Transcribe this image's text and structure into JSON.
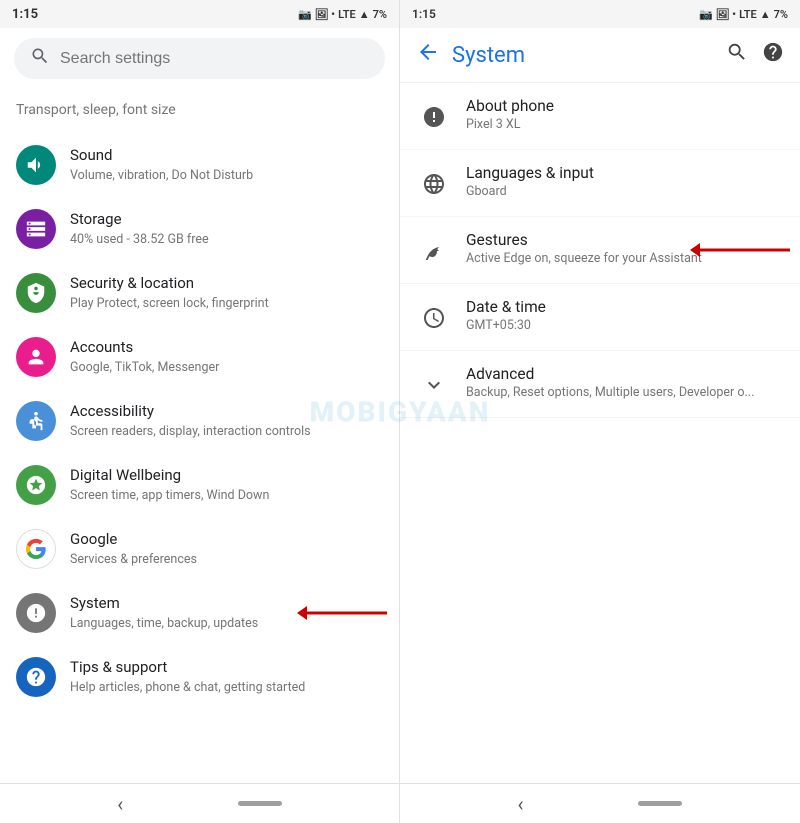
{
  "left_panel": {
    "status_bar": {
      "time": "1:15",
      "signal": "LTE",
      "battery": "7%"
    },
    "search": {
      "placeholder": "Search settings"
    },
    "truncated_item": {
      "text": "Transport, sleep, font size"
    },
    "items": [
      {
        "id": "sound",
        "icon_symbol": "🔊",
        "icon_class": "icon-teal",
        "title": "Sound",
        "subtitle": "Volume, vibration, Do Not Disturb"
      },
      {
        "id": "storage",
        "icon_symbol": "☰",
        "icon_class": "icon-purple",
        "title": "Storage",
        "subtitle": "40% used - 38.52 GB free"
      },
      {
        "id": "security",
        "icon_symbol": "🔒",
        "icon_class": "icon-green",
        "title": "Security & location",
        "subtitle": "Play Protect, screen lock, fingerprint"
      },
      {
        "id": "accounts",
        "icon_symbol": "👤",
        "icon_class": "icon-pink",
        "title": "Accounts",
        "subtitle": "Google, TikTok, Messenger"
      },
      {
        "id": "accessibility",
        "icon_symbol": "♿",
        "icon_class": "icon-blue-light",
        "title": "Accessibility",
        "subtitle": "Screen readers, display, interaction controls"
      },
      {
        "id": "digital-wellbeing",
        "icon_symbol": "⏱",
        "icon_class": "icon-green2",
        "title": "Digital Wellbeing",
        "subtitle": "Screen time, app timers, Wind Down"
      },
      {
        "id": "google",
        "icon_symbol": "G",
        "icon_class": "icon-google-g",
        "title": "Google",
        "subtitle": "Services & preferences",
        "has_red_arrow": false
      },
      {
        "id": "system",
        "icon_symbol": "ℹ",
        "icon_class": "icon-gray",
        "title": "System",
        "subtitle": "Languages, time, backup, updates",
        "has_red_arrow": true
      },
      {
        "id": "tips",
        "icon_symbol": "?",
        "icon_class": "icon-dark-blue",
        "title": "Tips & support",
        "subtitle": "Help articles, phone & chat, getting started"
      }
    ]
  },
  "right_panel": {
    "status_bar": {
      "time": "1:15",
      "signal": "LTE",
      "battery": "7%"
    },
    "header": {
      "title": "System",
      "back_label": "←",
      "search_label": "search",
      "help_label": "help"
    },
    "items": [
      {
        "id": "about-phone",
        "icon_symbol": "ℹ",
        "title": "About phone",
        "subtitle": "Pixel 3 XL"
      },
      {
        "id": "languages",
        "icon_symbol": "🌐",
        "title": "Languages & input",
        "subtitle": "Gboard"
      },
      {
        "id": "gestures",
        "icon_symbol": "📲",
        "title": "Gestures",
        "subtitle": "Active Edge on, squeeze for your Assistant",
        "has_red_arrow": true
      },
      {
        "id": "datetime",
        "icon_symbol": "🕐",
        "title": "Date & time",
        "subtitle": "GMT+05:30"
      },
      {
        "id": "advanced",
        "icon_symbol": "∨",
        "title": "Advanced",
        "subtitle": "Backup, Reset options, Multiple users, Developer o..."
      }
    ]
  },
  "watermark": "MOBIGYAAN"
}
